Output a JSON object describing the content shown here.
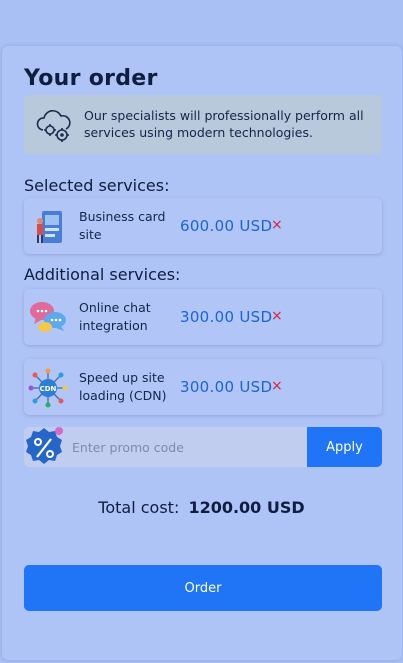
{
  "title": "Your order",
  "info": {
    "text": "Our specialists will professionally perform all services using modern technologies.",
    "icon": "cloud-gear-icon"
  },
  "selected": {
    "heading": "Selected services:",
    "items": [
      {
        "name": "Business card site",
        "price": "600.00 USD",
        "remove": "×",
        "icon": "business-card-icon"
      }
    ]
  },
  "additional": {
    "heading": "Additional services:",
    "items": [
      {
        "name": "Online chat integration",
        "price": "300.00 USD",
        "remove": "×",
        "icon": "chat-bubbles-icon"
      },
      {
        "name": "Speed up site loading (CDN)",
        "price": "300.00 USD",
        "remove": "×",
        "icon": "cdn-network-icon"
      }
    ]
  },
  "promo": {
    "placeholder": "Enter promo code",
    "value": "",
    "apply_label": "Apply",
    "icon": "percent-badge-icon"
  },
  "total": {
    "label": "Total cost:",
    "value": "1200.00 USD"
  },
  "order_label": "Order",
  "colors": {
    "accent": "#1f75f5",
    "price": "#1a63d8",
    "remove": "#d9203a",
    "background": "#a9c0f5"
  }
}
